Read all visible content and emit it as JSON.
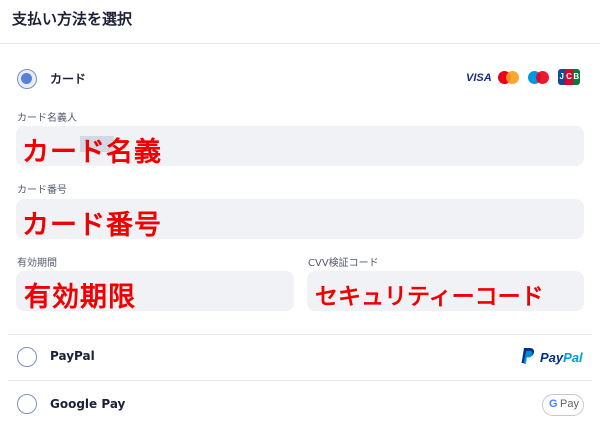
{
  "header": {
    "title": "支払い方法を選択"
  },
  "methods": {
    "card": {
      "label": "カード",
      "brands": {
        "visa": "VISA",
        "jcb": [
          "J",
          "C",
          "B"
        ]
      },
      "fields": {
        "name": {
          "label": "カード名義人",
          "value": "カード名義"
        },
        "number": {
          "label": "カード番号",
          "value": "カード番号"
        },
        "expiry": {
          "label": "有効期間",
          "value": "有効期限"
        },
        "cvv": {
          "label": "CVV検証コード",
          "value": "セキュリティーコード"
        }
      }
    },
    "paypal": {
      "label": "PayPal",
      "logo_pay": "Pay",
      "logo_pal": "Pal"
    },
    "googlepay": {
      "label": "Google Pay",
      "badge_g": "G",
      "badge_pay": "Pay"
    }
  },
  "colors": {
    "accent": "#5a7fd6",
    "field_bg": "#f1f2f5",
    "value_text": "#f00000",
    "mastercard_red": "#eb001b",
    "mastercard_yellow": "#f79e1b",
    "maestro_blue": "#0099df",
    "paypal_dark": "#003087",
    "paypal_light": "#009cde"
  },
  "icons": [
    "visa-logo-icon",
    "mastercard-icon",
    "maestro-icon",
    "jcb-icon",
    "paypal-p-icon",
    "google-g-icon"
  ]
}
